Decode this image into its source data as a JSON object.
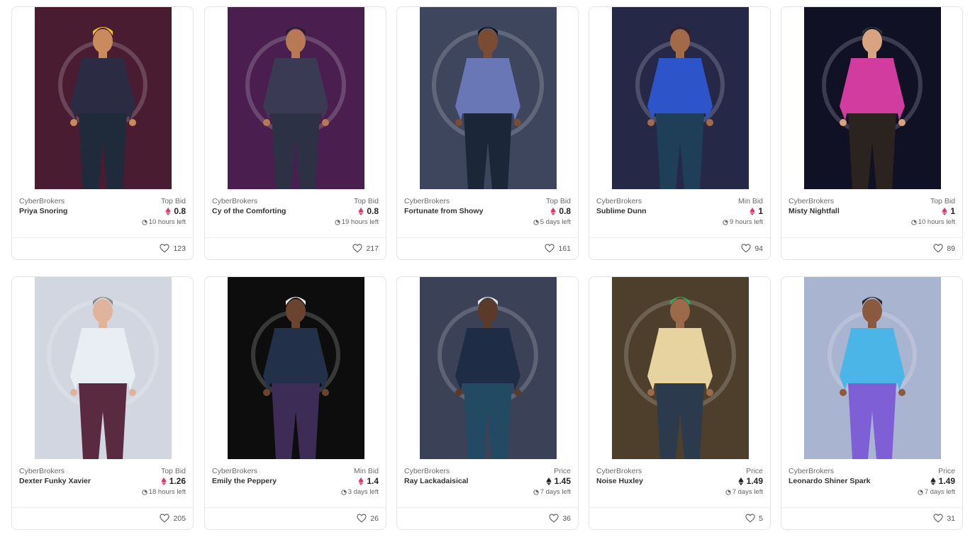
{
  "colors": {
    "eth_pink": "#e2336b",
    "eth_dark": "#222222"
  },
  "cards": [
    {
      "collection": "CyberBrokers",
      "name": "Priya Snoring",
      "bid_label": "Top Bid",
      "price": "0.8",
      "currency_icon": "eth-pink-icon",
      "time_left": "10 hours left",
      "likes": "123",
      "bg": "#4a1c32"
    },
    {
      "collection": "CyberBrokers",
      "name": "Cy of the Comforting",
      "bid_label": "Top Bid",
      "price": "0.8",
      "currency_icon": "eth-pink-icon",
      "time_left": "19 hours left",
      "likes": "217",
      "bg": "#4a1f4f"
    },
    {
      "collection": "CyberBrokers",
      "name": "Fortunate from Showy",
      "bid_label": "Top Bid",
      "price": "0.8",
      "currency_icon": "eth-pink-icon",
      "time_left": "5 days left",
      "likes": "161",
      "bg": "#3e465e"
    },
    {
      "collection": "CyberBrokers",
      "name": "Sublime Dunn",
      "bid_label": "Min Bid",
      "price": "1",
      "currency_icon": "eth-pink-icon",
      "time_left": "9 hours left",
      "likes": "94",
      "bg": "#262848"
    },
    {
      "collection": "CyberBrokers",
      "name": "Misty Nightfall",
      "bid_label": "Top Bid",
      "price": "1",
      "currency_icon": "eth-pink-icon",
      "time_left": "10 hours left",
      "likes": "89",
      "bg": "#111126"
    },
    {
      "collection": "CyberBrokers",
      "name": "Dexter Funky Xavier",
      "bid_label": "Top Bid",
      "price": "1.26",
      "currency_icon": "eth-pink-icon",
      "time_left": "18 hours left",
      "likes": "205",
      "bg": "#d2d6e1"
    },
    {
      "collection": "CyberBrokers",
      "name": "Emily the Peppery",
      "bid_label": "Min Bid",
      "price": "1.4",
      "currency_icon": "eth-pink-icon",
      "time_left": "3 days left",
      "likes": "26",
      "bg": "#0d0d0d"
    },
    {
      "collection": "CyberBrokers",
      "name": "Ray Lackadaisical",
      "bid_label": "Price",
      "price": "1.45",
      "currency_icon": "eth-dark-icon",
      "time_left": "7 days left",
      "likes": "36",
      "bg": "#3b4257"
    },
    {
      "collection": "CyberBrokers",
      "name": "Noise Huxley",
      "bid_label": "Price",
      "price": "1.49",
      "currency_icon": "eth-dark-icon",
      "time_left": "7 days left",
      "likes": "5",
      "bg": "#4d3f2c"
    },
    {
      "collection": "CyberBrokers",
      "name": "Leonardo Shiner Spark",
      "bid_label": "Price",
      "price": "1.49",
      "currency_icon": "eth-dark-icon",
      "time_left": "7 days left",
      "likes": "31",
      "bg": "#a9b4d0"
    }
  ]
}
